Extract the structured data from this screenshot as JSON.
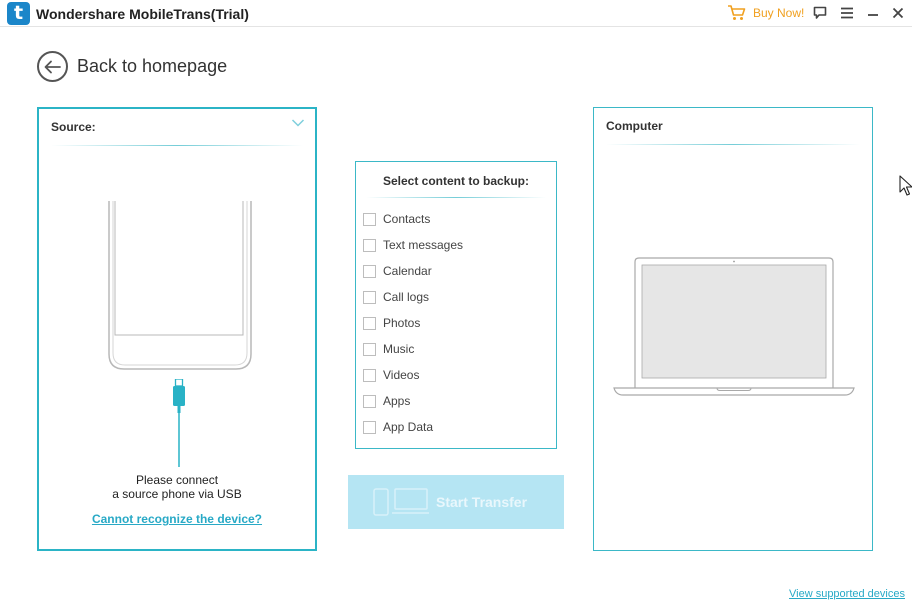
{
  "titlebar": {
    "logo_letter": "t",
    "title": "Wondershare MobileTrans(Trial)",
    "buy_now": "Buy Now!",
    "icons": [
      "cart-icon",
      "feedback-icon",
      "menu-icon",
      "minimize-icon",
      "close-icon"
    ]
  },
  "back": {
    "label": "Back to homepage",
    "icon": "arrow-left-icon"
  },
  "source": {
    "title": "Source:",
    "connect_line1": "Please connect",
    "connect_line2": "a source phone via USB",
    "help_link": "Cannot recognize the device?"
  },
  "content": {
    "title": "Select content to backup:",
    "options": [
      "Contacts",
      "Text messages",
      "Calendar",
      "Call logs",
      "Photos",
      "Music",
      "Videos",
      "Apps",
      "App Data"
    ]
  },
  "start_transfer": {
    "label": "Start Transfer",
    "enabled": false
  },
  "computer": {
    "title": "Computer"
  },
  "footer": {
    "supported_link": "View supported devices"
  },
  "colors": {
    "accent": "#2bb4c6",
    "link": "#28a9c6",
    "buy": "#f0a020",
    "button_disabled": "#b5e5f3",
    "logo": "#1b86c9"
  }
}
